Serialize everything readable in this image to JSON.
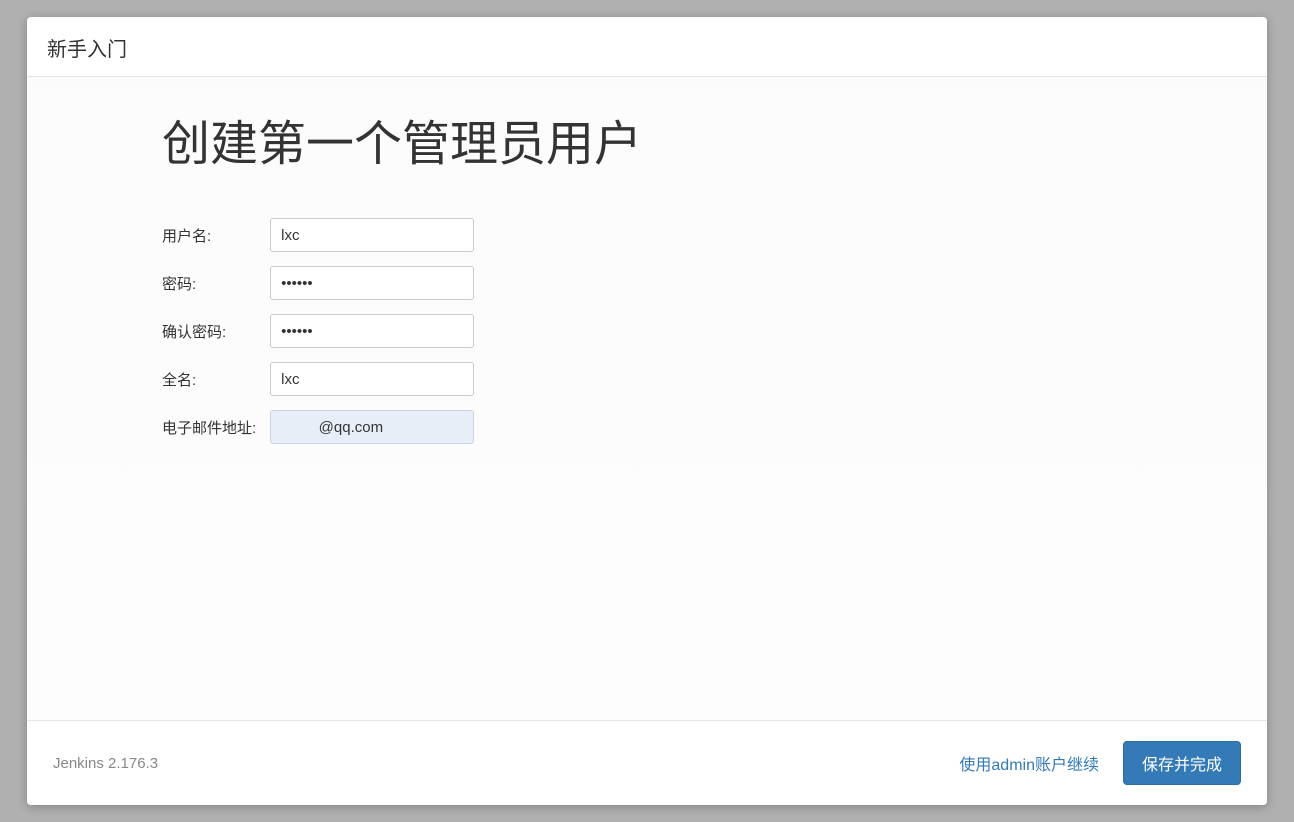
{
  "header": {
    "title": "新手入门"
  },
  "main": {
    "heading": "创建第一个管理员用户",
    "form": {
      "username": {
        "label": "用户名:",
        "value": "lxc"
      },
      "password": {
        "label": "密码:",
        "value": "••••••"
      },
      "confirm_password": {
        "label": "确认密码:",
        "value": "••••••"
      },
      "fullname": {
        "label": "全名:",
        "value": "lxc"
      },
      "email": {
        "label": "电子邮件地址:",
        "value": "         @qq.com"
      }
    }
  },
  "footer": {
    "version": "Jenkins 2.176.3",
    "continue_as_admin": "使用admin账户继续",
    "save_and_finish": "保存并完成"
  }
}
